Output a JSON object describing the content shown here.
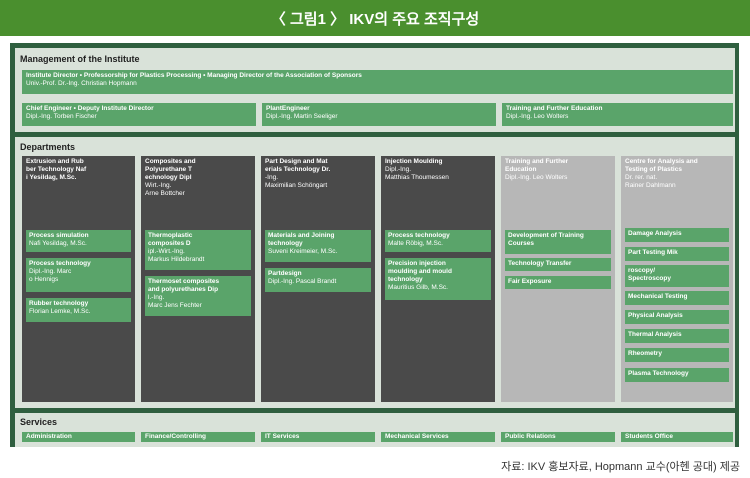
{
  "header": {
    "title": "〈 그림1 〉 IKV의 주요 조직구성"
  },
  "management": {
    "section_title": "Management of the Institute",
    "director": {
      "title": "Institute Director • Professorship for Plastics Processing • Managing Director of the Association of  Sponsors",
      "name": "Univ.-Prof. Dr.-Ing. Christian Hopmann"
    },
    "deputies": [
      {
        "title": "Chief Engineer • Deputy Institute Director",
        "name": "Dipl.-Ing. Torben Fischer"
      },
      {
        "title": "PlantEngineer",
        "name": "Dipl.-Ing. Martin Seeliger"
      },
      {
        "title": "Training and Further Education",
        "name": "Dipl.-Ing. Leo Wolters"
      }
    ]
  },
  "departments": {
    "section_title": "Departments",
    "columns": [
      {
        "title": "Extrusion and  Rub\nber Technology  Naf\ni Yesildag, M.Sc.",
        "subtitle": "",
        "items": [
          {
            "title": "Process simulation",
            "name": "Nafi Yesildag, M.Sc."
          },
          {
            "title": "Process technology",
            "name": "Dipl.-Ing.   Marc\no Hennigs"
          },
          {
            "title": "Rubber technology",
            "name": "Florian Lemke, M.Sc."
          }
        ]
      },
      {
        "title": "Composites and\nPolyurethane  T\nechnology  Dipl",
        "subtitle": "Wirt.-Ing.\nArne Bottcher",
        "items": [
          {
            "title": "Thermoplastic\ncomposites  D",
            "name": "ipl.-Wirt.-Ing.\nMarkus Hildebrandt"
          },
          {
            "title": "Thermoset composites\nand polyurethanes  Dip",
            "name": "l.-Ing.\nMarc Jens Fechter"
          }
        ]
      },
      {
        "title": "Part Design and  Mat\nerials Technology  Dr.",
        "subtitle": "-Ing.\nMaximilian Schöngart",
        "items": [
          {
            "title": "Materials and Joining\ntechnology",
            "name": "Suveni Kreimeier, M.Sc."
          },
          {
            "title": "Partdesign",
            "name": "Dipl.-Ing. Pascal Brandt"
          }
        ]
      },
      {
        "title": "Injection Moulding",
        "subtitle": "Dipl.-Ing.\nMatthias Thoumessen",
        "items": [
          {
            "title": "Process technology",
            "name": "Malte Röbig, M.Sc."
          },
          {
            "title": "Precision injection\nmoulding and mould\ntechnology",
            "name": "Mauritius Gilb, M.Sc."
          }
        ]
      },
      {
        "title": "Training and Further\nEducation",
        "subtitle": "Dipl.-Ing. Leo Wolters",
        "items": [
          {
            "title": "Development of Training\nCourses",
            "name": ""
          },
          {
            "title": "Technology Transfer",
            "name": ""
          },
          {
            "title": "Fair Exposure",
            "name": ""
          }
        ]
      },
      {
        "title": "Centre for Analysis and\nTesting of Plastics",
        "subtitle": "Dr. rer. nat.\nRainer Dahlmann",
        "items": [
          {
            "title": "Damage Analysis",
            "name": ""
          },
          {
            "title": "Part Testing  Mik",
            "name": ""
          },
          {
            "title": "roscopy/\nSpectroscopy",
            "name": ""
          },
          {
            "title": "Mechanical Testing",
            "name": ""
          },
          {
            "title": "Physical Analysis",
            "name": ""
          },
          {
            "title": "Thermal Analysis",
            "name": ""
          },
          {
            "title": "Rheometry",
            "name": ""
          },
          {
            "title": "Plasma Technology",
            "name": ""
          }
        ]
      }
    ]
  },
  "services": {
    "section_title": "Services",
    "items": [
      "Administration",
      "Finance/Controlling",
      "IT Services",
      "Mechanical Services",
      "Public Relations",
      "Students Office"
    ]
  },
  "credit": "자료: IKV 홍보자료, Hopmann 교수(아헨 공대) 제공"
}
